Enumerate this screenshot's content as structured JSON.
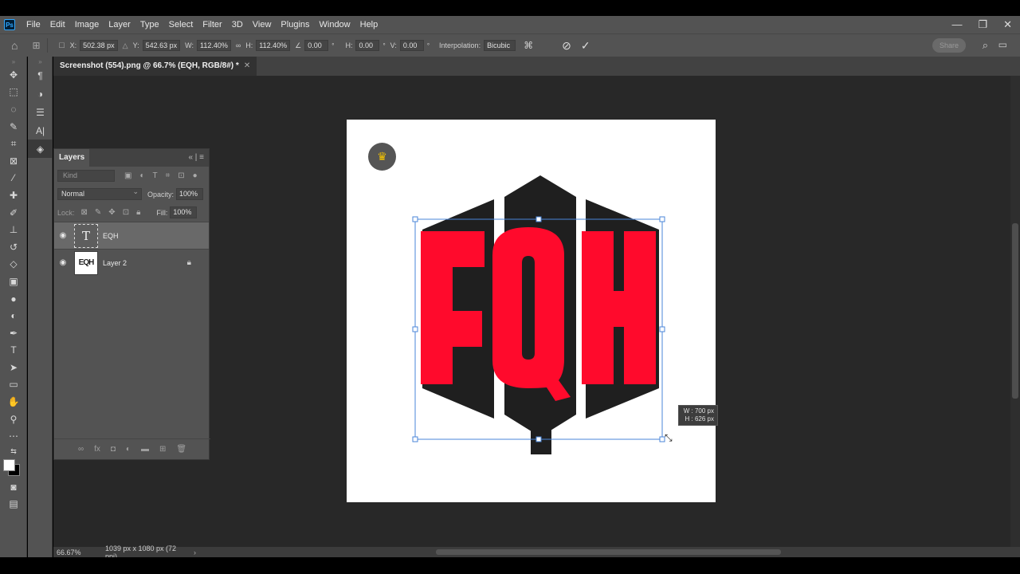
{
  "app": {
    "logo": "Ps"
  },
  "menu": [
    "File",
    "Edit",
    "Image",
    "Layer",
    "Type",
    "Select",
    "Filter",
    "3D",
    "View",
    "Plugins",
    "Window",
    "Help"
  ],
  "window_controls": {
    "minimize": "—",
    "restore": "❐",
    "close": "✕"
  },
  "options": {
    "x_label": "X:",
    "x_value": "502.38 px",
    "y_label": "Y:",
    "y_value": "542.63 px",
    "w_label": "W:",
    "w_value": "112.40%",
    "h_label": "H:",
    "h_value": "112.40%",
    "angle_value": "0.00",
    "hskew_label": "H:",
    "hskew_value": "0.00",
    "vskew_label": "V:",
    "vskew_value": "0.00",
    "interp_label": "Interpolation:",
    "interp_value": "Bicubic",
    "share_label": "Share"
  },
  "document": {
    "tab_title": "Screenshot (554).png @ 66.7% (EQH, RGB/8#) *"
  },
  "layers_panel": {
    "title": "Layers",
    "kind_placeholder": "Kind",
    "blend_mode": "Normal",
    "opacity_label": "Opacity:",
    "opacity_value": "100%",
    "lock_label": "Lock:",
    "fill_label": "Fill:",
    "fill_value": "100%",
    "layers": [
      {
        "name": "EQH",
        "thumb": "T",
        "selected": true
      },
      {
        "name": "Layer 2",
        "thumb": "EQH",
        "locked": true
      }
    ]
  },
  "canvas_content": {
    "text": "EQH",
    "text_color": "#ff0a2c",
    "logo_color": "#1f1f1f"
  },
  "transform_tooltip": {
    "w": "W : 700 px",
    "h": "H : 626 px"
  },
  "status": {
    "zoom": "66.67%",
    "doc_info": "1039 px x 1080 px (72 ppi)"
  }
}
